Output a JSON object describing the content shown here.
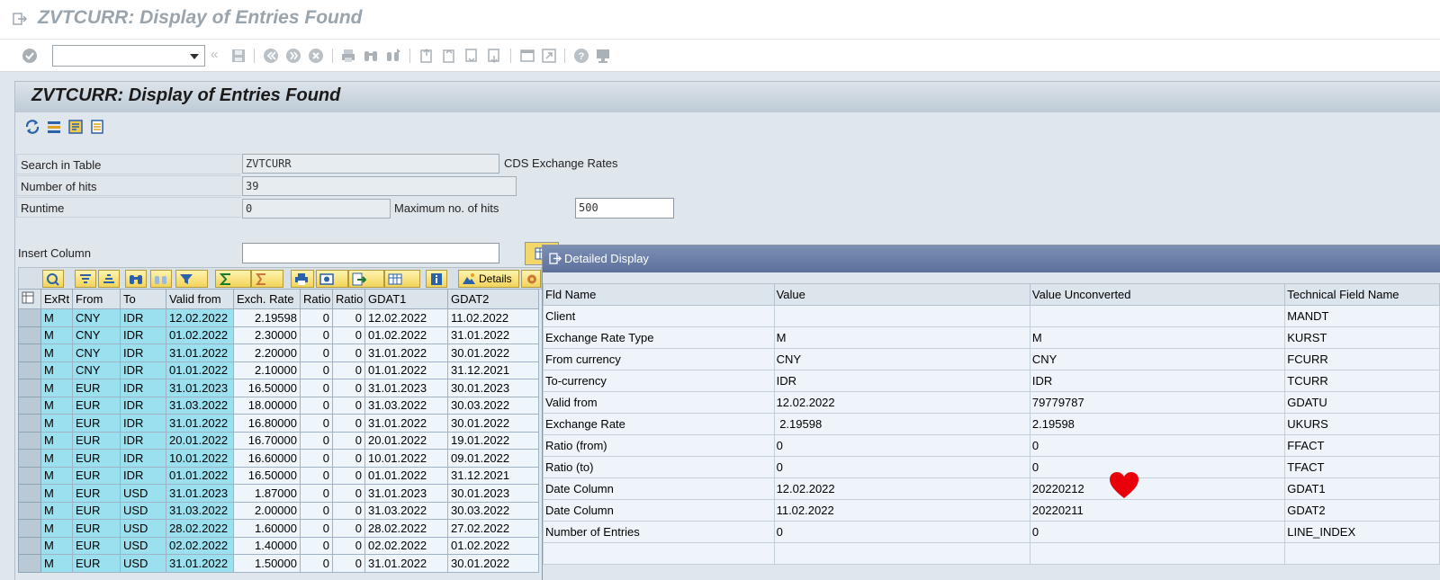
{
  "window": {
    "title": "ZVTCURR: Display of Entries Found"
  },
  "toolbar": {
    "command_value": "",
    "icons": [
      "enter-icon",
      "save-icon",
      "back-icon",
      "exit-icon",
      "cancel-icon",
      "print-icon",
      "find-icon",
      "find-next-icon",
      "first-page-icon",
      "previous-page-icon",
      "next-page-icon",
      "last-page-icon",
      "new-session-icon",
      "shortcut-icon",
      "help-icon",
      "customize-layout-icon"
    ]
  },
  "panel": {
    "title": "ZVTCURR: Display of Entries Found",
    "toolbar_icons": [
      "refresh-icon",
      "selection-icon",
      "settings-icon",
      "checklist-icon"
    ]
  },
  "form": {
    "search_label": "Search in Table",
    "table_value": "ZVTCURR",
    "table_description": "CDS Exchange Rates",
    "hits_label": "Number of hits",
    "hits_value": "39",
    "runtime_label": "Runtime",
    "runtime_value": "0",
    "max_hits_label": "Maximum no. of hits",
    "max_hits_value": "500",
    "insert_column_label": "Insert Column",
    "insert_column_value": ""
  },
  "alv": {
    "details_label": "Details",
    "columns": [
      "ExRt",
      "From",
      "To",
      "Valid from",
      "Exch. Rate",
      "Ratio",
      "Ratio",
      "GDAT1",
      "GDAT2"
    ],
    "rows": [
      [
        "M",
        "CNY",
        "IDR",
        "12.02.2022",
        "2.19598",
        "0",
        "0",
        "12.02.2022",
        "11.02.2022"
      ],
      [
        "M",
        "CNY",
        "IDR",
        "01.02.2022",
        "2.30000",
        "0",
        "0",
        "01.02.2022",
        "31.01.2022"
      ],
      [
        "M",
        "CNY",
        "IDR",
        "31.01.2022",
        "2.20000",
        "0",
        "0",
        "31.01.2022",
        "30.01.2022"
      ],
      [
        "M",
        "CNY",
        "IDR",
        "01.01.2022",
        "2.10000",
        "0",
        "0",
        "01.01.2022",
        "31.12.2021"
      ],
      [
        "M",
        "EUR",
        "IDR",
        "31.01.2023",
        "16.50000",
        "0",
        "0",
        "31.01.2023",
        "30.01.2023"
      ],
      [
        "M",
        "EUR",
        "IDR",
        "31.03.2022",
        "18.00000",
        "0",
        "0",
        "31.03.2022",
        "30.03.2022"
      ],
      [
        "M",
        "EUR",
        "IDR",
        "31.01.2022",
        "16.80000",
        "0",
        "0",
        "31.01.2022",
        "30.01.2022"
      ],
      [
        "M",
        "EUR",
        "IDR",
        "20.01.2022",
        "16.70000",
        "0",
        "0",
        "20.01.2022",
        "19.01.2022"
      ],
      [
        "M",
        "EUR",
        "IDR",
        "10.01.2022",
        "16.60000",
        "0",
        "0",
        "10.01.2022",
        "09.01.2022"
      ],
      [
        "M",
        "EUR",
        "IDR",
        "01.01.2022",
        "16.50000",
        "0",
        "0",
        "01.01.2022",
        "31.12.2021"
      ],
      [
        "M",
        "EUR",
        "USD",
        "31.01.2023",
        "1.87000",
        "0",
        "0",
        "31.01.2023",
        "30.01.2023"
      ],
      [
        "M",
        "EUR",
        "USD",
        "31.03.2022",
        "2.00000",
        "0",
        "0",
        "31.03.2022",
        "30.03.2022"
      ],
      [
        "M",
        "EUR",
        "USD",
        "28.02.2022",
        "1.60000",
        "0",
        "0",
        "28.02.2022",
        "27.02.2022"
      ],
      [
        "M",
        "EUR",
        "USD",
        "02.02.2022",
        "1.40000",
        "0",
        "0",
        "02.02.2022",
        "01.02.2022"
      ],
      [
        "M",
        "EUR",
        "USD",
        "31.01.2022",
        "1.50000",
        "0",
        "0",
        "31.01.2022",
        "30.01.2022"
      ]
    ]
  },
  "popup": {
    "title": "Detailed Display",
    "columns": [
      "Fld Name",
      "Value",
      "Value Unconverted",
      "Technical Field Name"
    ],
    "rows": [
      [
        "Client",
        "",
        "",
        "MANDT"
      ],
      [
        "Exchange Rate Type",
        "M",
        "M",
        "KURST"
      ],
      [
        "From currency",
        "CNY",
        "CNY",
        "FCURR"
      ],
      [
        "To-currency",
        "IDR",
        "IDR",
        "TCURR"
      ],
      [
        "Valid from",
        "12.02.2022",
        "79779787",
        "GDATU"
      ],
      [
        "Exchange Rate",
        " 2.19598",
        "2.19598",
        "UKURS"
      ],
      [
        "Ratio (from)",
        "0",
        "0",
        "FFACT"
      ],
      [
        "Ratio (to)",
        "0",
        "0",
        "TFACT"
      ],
      [
        "Date Column",
        "12.02.2022",
        "20220212",
        "GDAT1"
      ],
      [
        "Date Column",
        "11.02.2022",
        "20220211",
        "GDAT2"
      ],
      [
        "Number of Entries",
        "0",
        "0",
        "LINE_INDEX"
      ],
      [
        "",
        "",
        "",
        ""
      ]
    ]
  },
  "colors": {
    "key_column": "#9be0ee",
    "row_bg": "#eef6fb",
    "popup_header": "#6b7fa8",
    "annotation": "#e8000b"
  }
}
